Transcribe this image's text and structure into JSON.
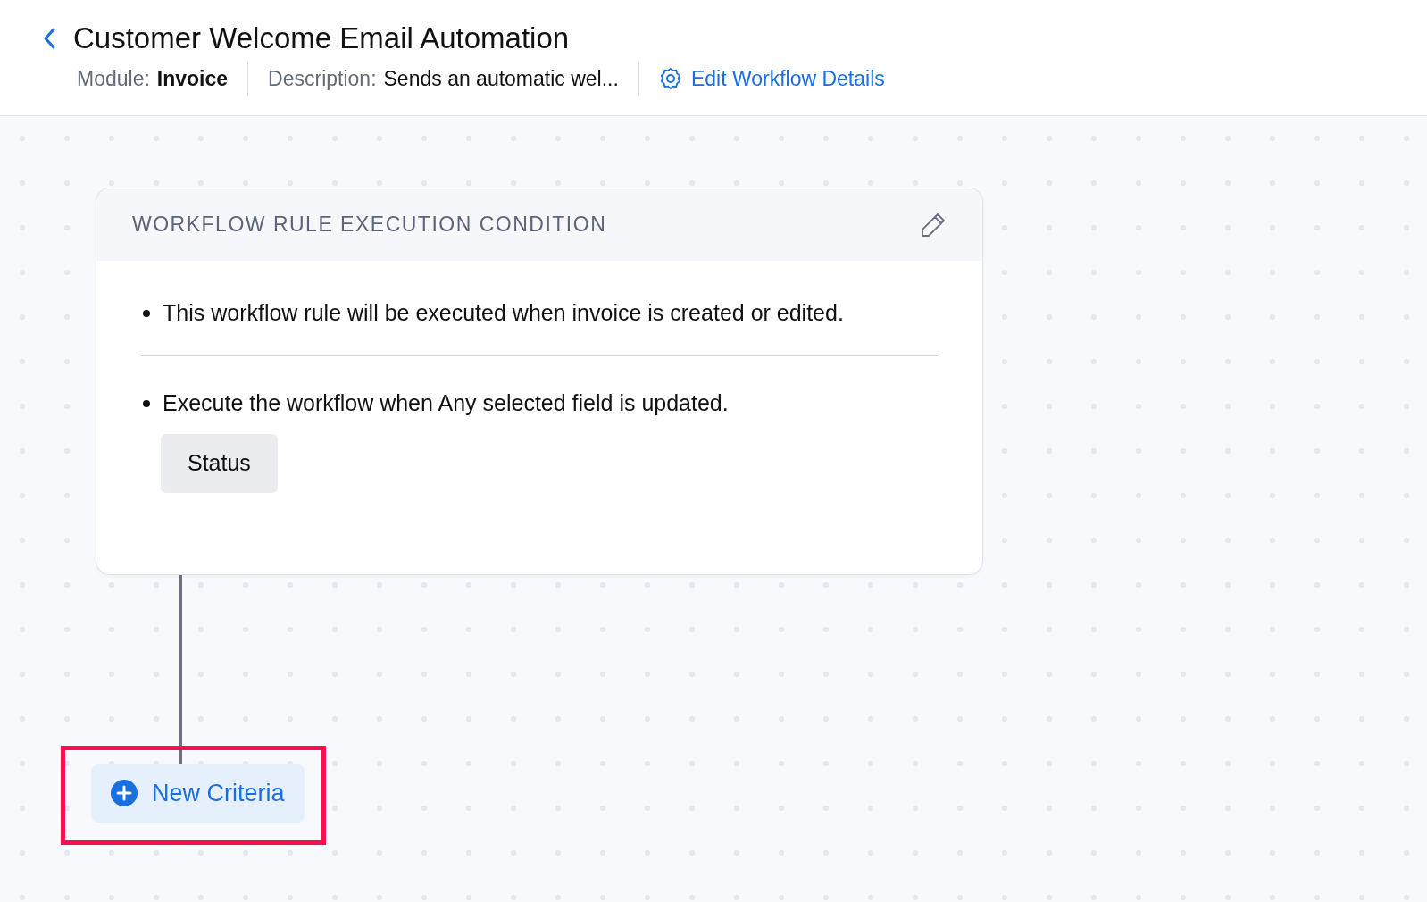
{
  "header": {
    "title": "Customer Welcome Email Automation",
    "meta": [
      {
        "label": "Module:",
        "value": "Invoice"
      },
      {
        "label": "Description:",
        "value": "Sends an automatic wel..."
      }
    ],
    "edit_link": "Edit Workflow Details"
  },
  "condition_card": {
    "title": "WORKFLOW RULE EXECUTION CONDITION",
    "conditions": [
      {
        "text": "This workflow rule will be executed when invoice is created or edited."
      },
      {
        "text": "Execute the workflow when Any selected field is updated.",
        "fields": [
          "Status"
        ]
      }
    ]
  },
  "new_criteria_button": {
    "label": "New Criteria",
    "highlighted": true
  }
}
